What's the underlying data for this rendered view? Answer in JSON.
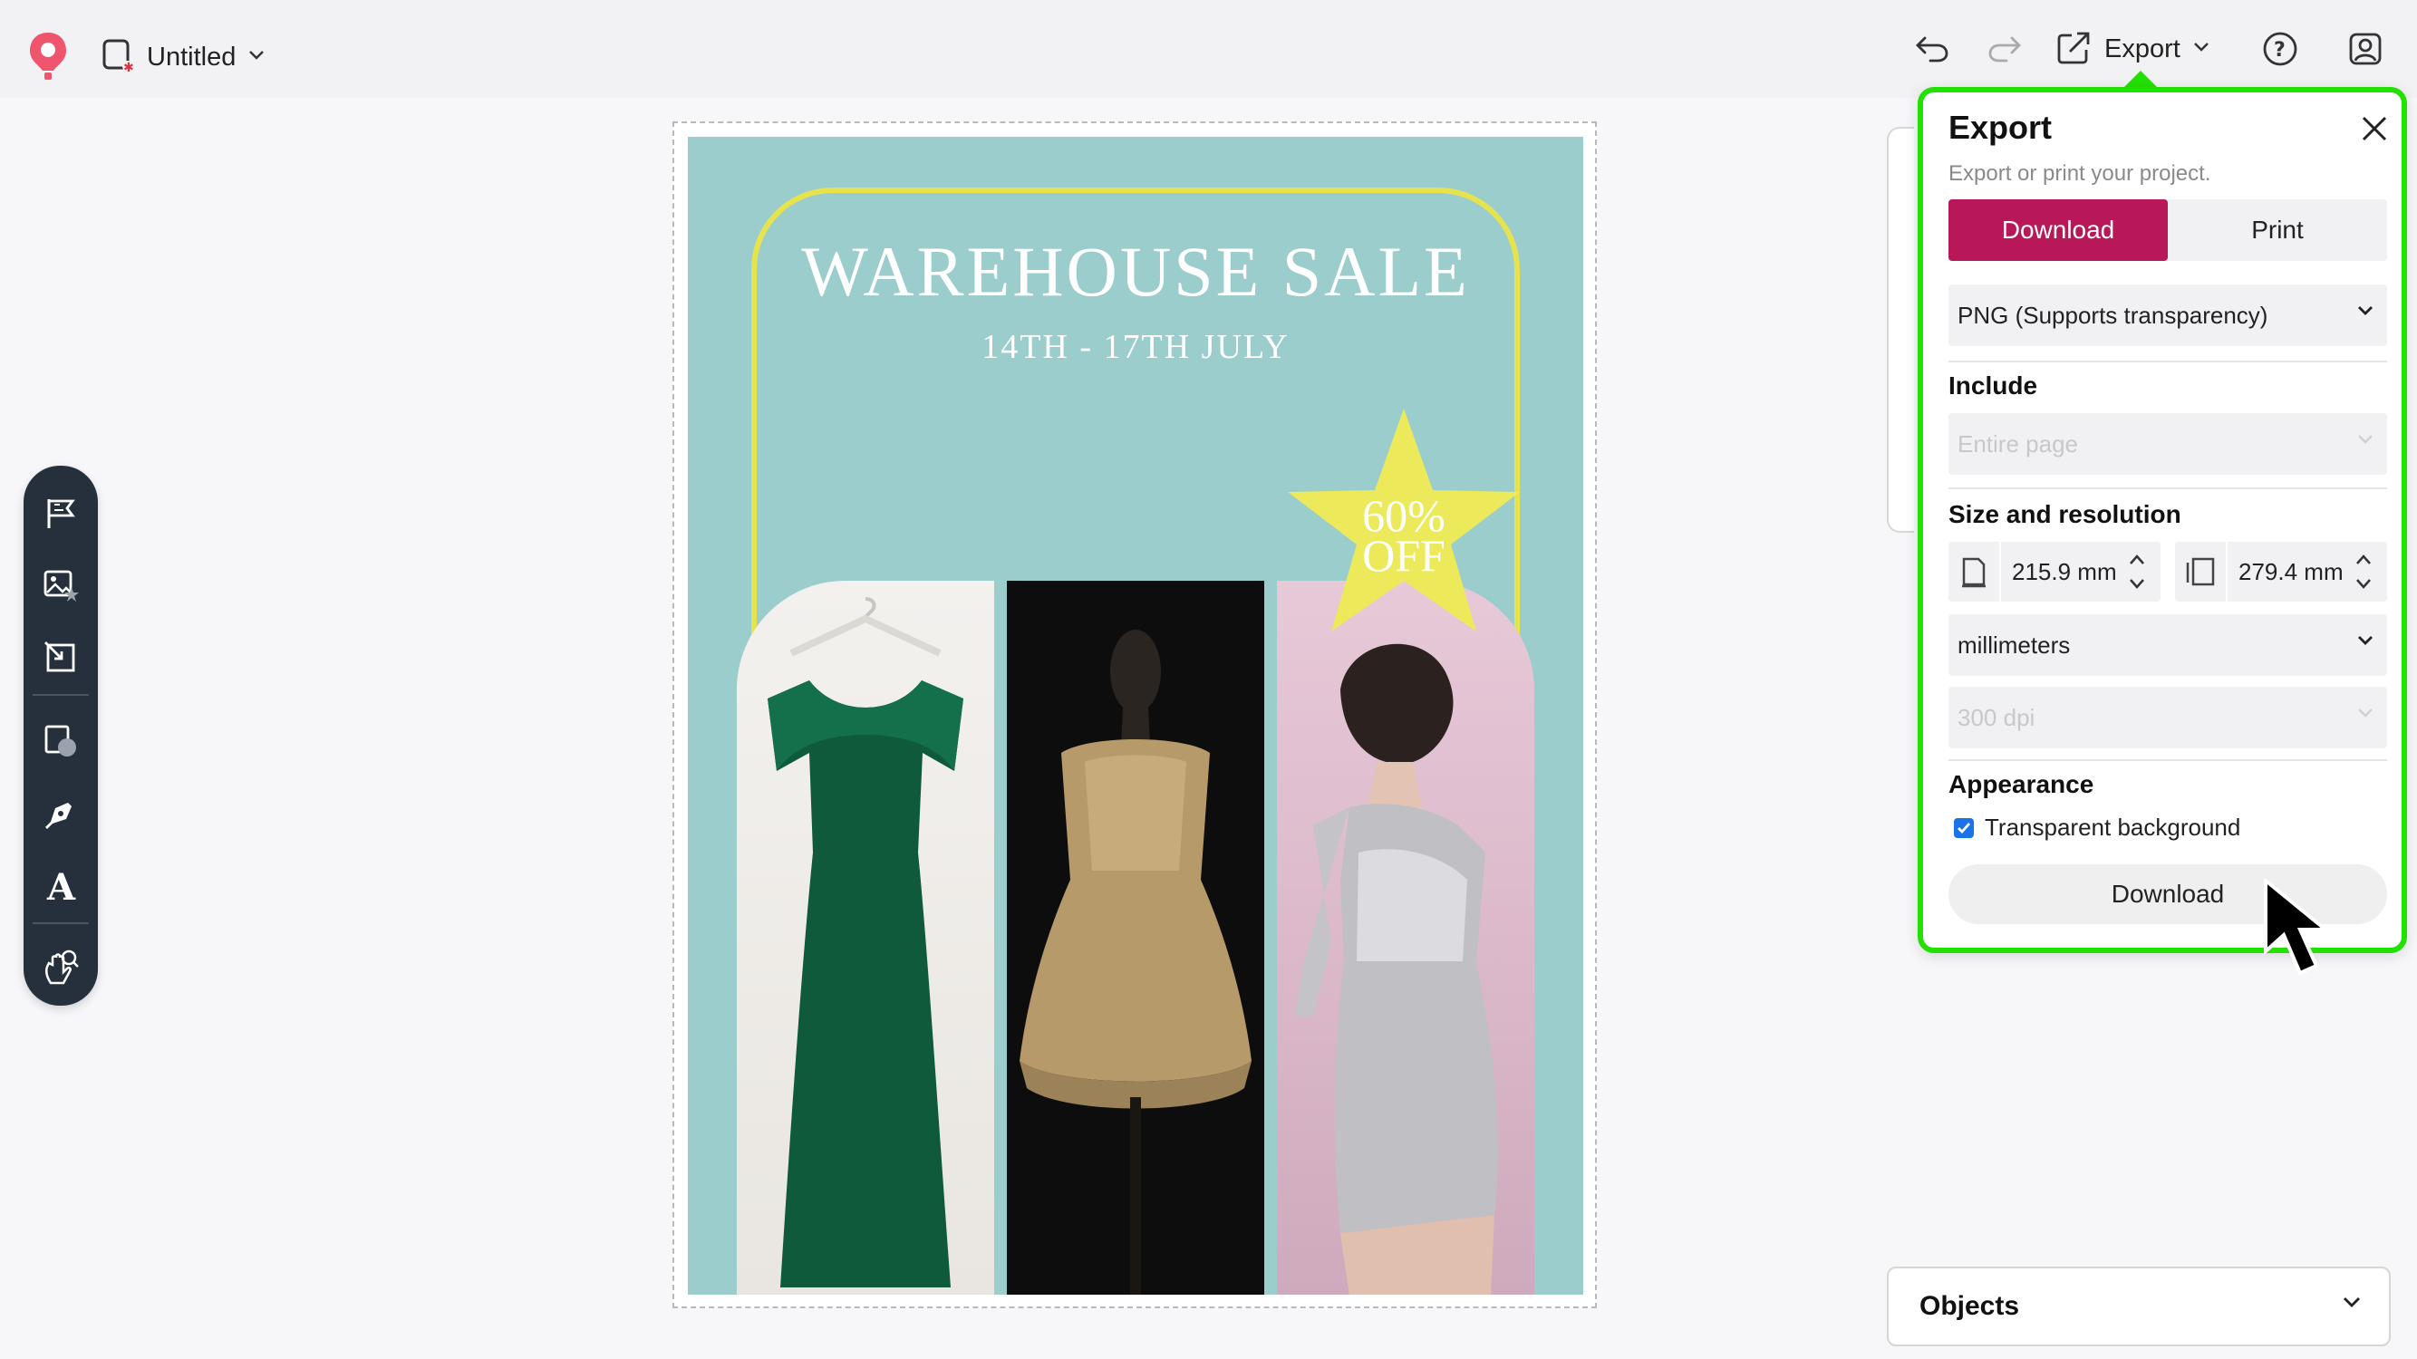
{
  "header": {
    "document_title": "Untitled",
    "export_label": "Export"
  },
  "poster": {
    "title": "WAREHOUSE SALE",
    "dates": "14TH - 17TH JULY",
    "badge_line1": "60%",
    "badge_line2": "OFF",
    "colors": {
      "background": "#9ccdcd",
      "frame": "#e7e34e",
      "badge": "#ecea5a"
    }
  },
  "toolbar": {
    "tools": [
      "flag-icon",
      "image-star-icon",
      "resize-arrow-icon",
      "shapes-icon",
      "pen-icon",
      "text-icon",
      "hand-zoom-icon"
    ]
  },
  "export_panel": {
    "title": "Export",
    "description": "Export or print your project.",
    "tabs": {
      "download": "Download",
      "print": "Print",
      "active": "download"
    },
    "format": "PNG (Supports transparency)",
    "include_label": "Include",
    "include_value": "Entire page",
    "size_label": "Size and resolution",
    "width": "215.9 mm",
    "height": "279.4 mm",
    "units": "millimeters",
    "dpi": "300 dpi",
    "appearance_label": "Appearance",
    "transparent_background_label": "Transparent background",
    "transparent_background_checked": true,
    "download_button": "Download",
    "accent_color": "#b8185a",
    "highlight_color": "#22e000"
  },
  "objects_panel": {
    "label": "Objects"
  }
}
